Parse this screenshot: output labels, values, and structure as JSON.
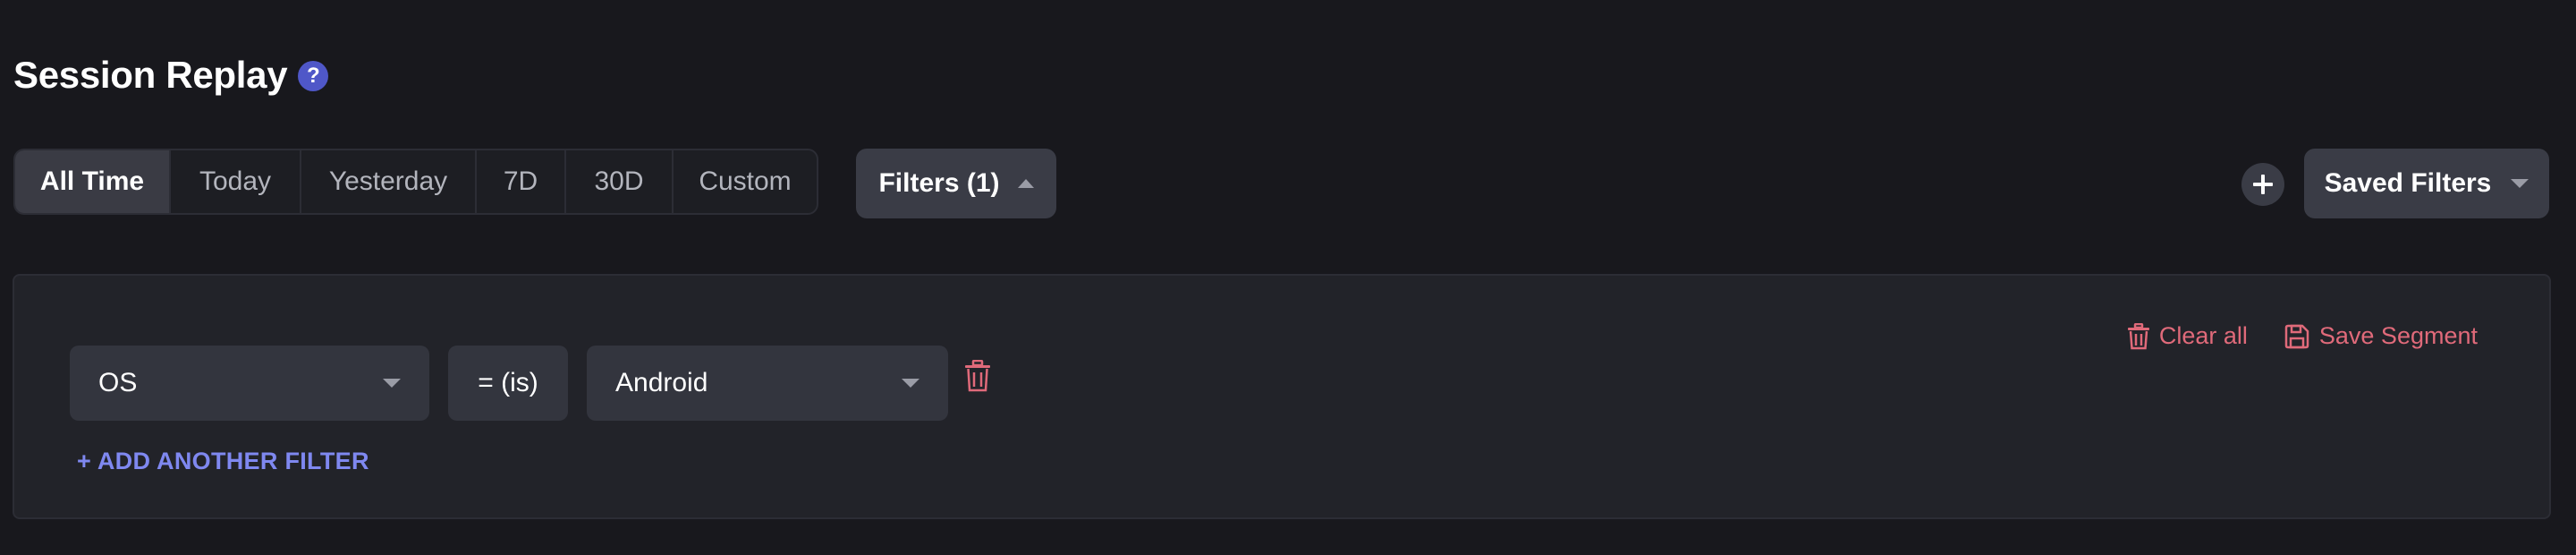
{
  "header": {
    "title": "Session Replay",
    "help_glyph": "?"
  },
  "date_range": {
    "options": [
      "All Time",
      "Today",
      "Yesterday",
      "7D",
      "30D",
      "Custom"
    ],
    "selected": "All Time"
  },
  "filters_toggle": {
    "label": "Filters (1)",
    "expanded": true
  },
  "saved_filters": {
    "label": "Saved Filters"
  },
  "filter_panel": {
    "actions": {
      "clear_all": "Clear all",
      "save_segment": "Save Segment"
    },
    "filters": [
      {
        "field": "OS",
        "operator": "= (is)",
        "value": "Android"
      }
    ],
    "add_filter_label": "+ ADD ANOTHER FILTER"
  },
  "colors": {
    "background": "#18181d",
    "panel": "#222329",
    "control": "#33353e",
    "accent_link": "#7f88f0",
    "danger": "#e06a7a",
    "help_badge": "#4f57c8"
  }
}
